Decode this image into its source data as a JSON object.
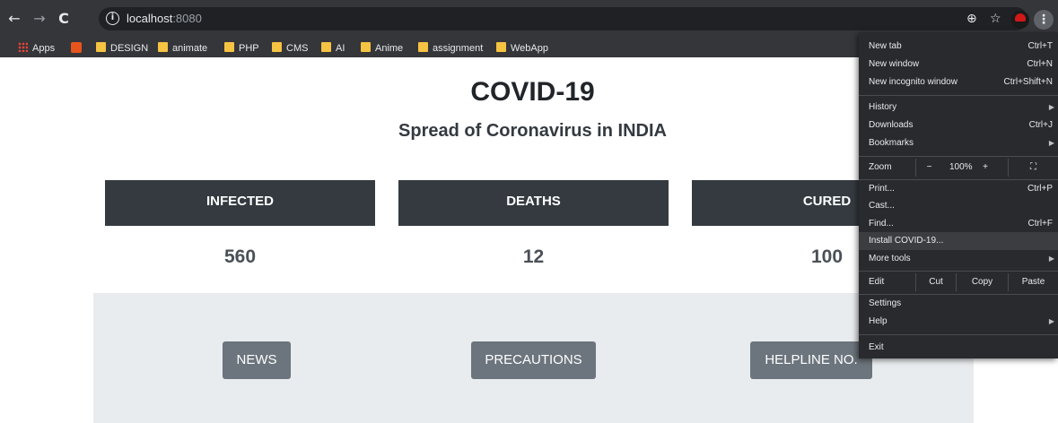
{
  "browser": {
    "nav": {
      "back": "←",
      "forward": "→",
      "reload": "C"
    },
    "url_host": "localhost",
    "url_port": ":8080",
    "icons": {
      "add": "⊕",
      "star": "☆",
      "menu": "⋮",
      "info": "i"
    }
  },
  "bookmarks": [
    {
      "label": "Apps",
      "icon": "apps-grid-icon"
    },
    {
      "label": "",
      "icon": "bookmark-favicon"
    },
    {
      "label": "DESIGN",
      "icon": "folder-icon"
    },
    {
      "label": "animate",
      "icon": "folder-icon"
    },
    {
      "label": "PHP",
      "icon": "folder-icon"
    },
    {
      "label": "CMS",
      "icon": "folder-icon"
    },
    {
      "label": "AI",
      "icon": "folder-icon"
    },
    {
      "label": "Anime",
      "icon": "folder-icon"
    },
    {
      "label": "assignment",
      "icon": "folder-icon"
    },
    {
      "label": "WebApp",
      "icon": "folder-icon"
    }
  ],
  "page": {
    "title": "COVID-19",
    "subtitle": "Spread of Coronavirus in INDIA",
    "stats": [
      {
        "label": "INFECTED",
        "value": "560"
      },
      {
        "label": "DEATHS",
        "value": "12"
      },
      {
        "label": "CURED",
        "value": "100"
      }
    ],
    "buttons": [
      "NEWS",
      "PRECAUTIONS",
      "HELPLINE NO."
    ]
  },
  "menu": {
    "new_tab": {
      "label": "New tab",
      "shortcut": "Ctrl+T"
    },
    "new_window": {
      "label": "New window",
      "shortcut": "Ctrl+N"
    },
    "new_incognito": {
      "label": "New incognito window",
      "shortcut": "Ctrl+Shift+N"
    },
    "history": {
      "label": "History"
    },
    "downloads": {
      "label": "Downloads",
      "shortcut": "Ctrl+J"
    },
    "bookmarks": {
      "label": "Bookmarks"
    },
    "zoom": {
      "label": "Zoom",
      "minus": "−",
      "level": "100%",
      "plus": "+",
      "fullscreen": "⛶"
    },
    "print": {
      "label": "Print...",
      "shortcut": "Ctrl+P"
    },
    "cast": {
      "label": "Cast..."
    },
    "find": {
      "label": "Find...",
      "shortcut": "Ctrl+F"
    },
    "install": {
      "label": "Install COVID-19..."
    },
    "more_tools": {
      "label": "More tools"
    },
    "edit": {
      "label": "Edit",
      "cut": "Cut",
      "copy": "Copy",
      "paste": "Paste"
    },
    "settings": {
      "label": "Settings"
    },
    "help": {
      "label": "Help"
    },
    "exit": {
      "label": "Exit"
    },
    "submenu_arrow": "▶"
  }
}
